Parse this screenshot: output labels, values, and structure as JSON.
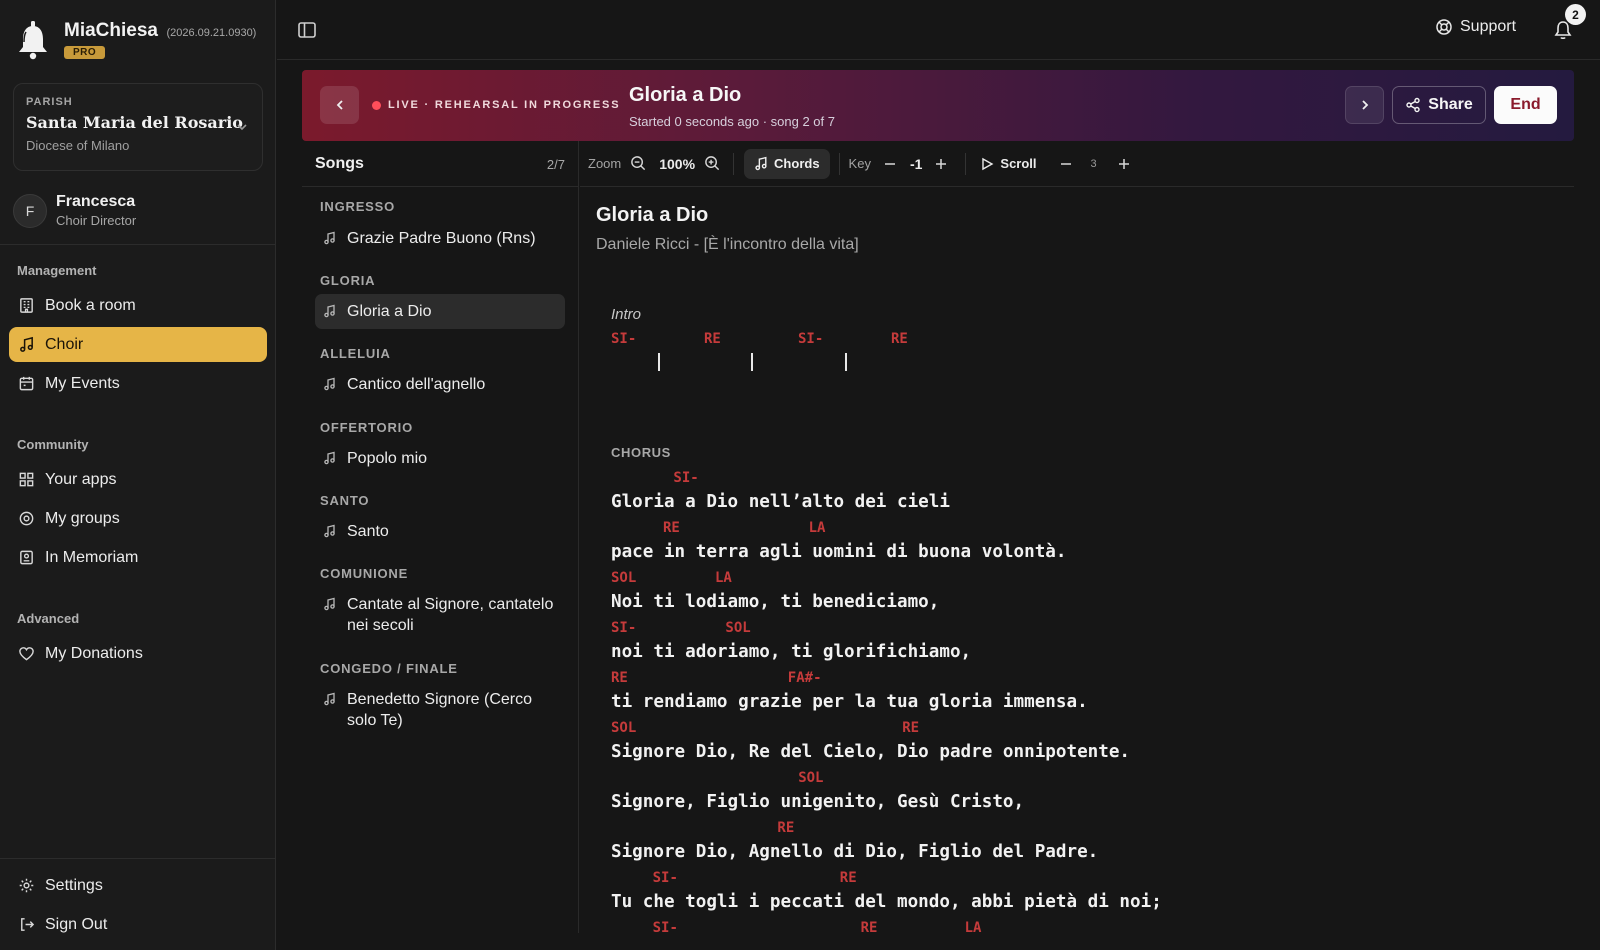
{
  "brand": {
    "name": "MiaChiesa",
    "version": "(2026.09.21.0930)",
    "badge": "PRO"
  },
  "parish": {
    "label": "PARISH",
    "name": "Santa Maria del Rosario",
    "diocese": "Diocese of Milano"
  },
  "user": {
    "initial": "F",
    "name": "Francesca",
    "role": "Choir Director"
  },
  "nav": {
    "management_label": "Management",
    "book_room": "Book a room",
    "choir": "Choir",
    "my_events": "My Events",
    "community_label": "Community",
    "your_apps": "Your apps",
    "my_groups": "My groups",
    "in_memoriam": "In Memoriam",
    "advanced_label": "Advanced",
    "my_donations": "My Donations",
    "settings": "Settings",
    "sign_out": "Sign Out"
  },
  "topbar": {
    "support": "Support",
    "notifications": "2"
  },
  "banner": {
    "live_label": "LIVE · REHEARSAL IN PROGRESS",
    "title": "Gloria a Dio",
    "subtitle": "Started 0 seconds ago · song 2 of 7",
    "share": "Share",
    "end": "End",
    "live_color": "#ff4d5a"
  },
  "songs": {
    "title": "Songs",
    "count": "2/7",
    "sections": [
      {
        "name": "INGRESSO",
        "songs": [
          "Grazie Padre Buono (Rns)"
        ]
      },
      {
        "name": "GLORIA",
        "songs": [
          "Gloria a Dio"
        ]
      },
      {
        "name": "ALLELUIA",
        "songs": [
          "Cantico dell'agnello"
        ]
      },
      {
        "name": "OFFERTORIO",
        "songs": [
          "Popolo mio"
        ]
      },
      {
        "name": "SANTO",
        "songs": [
          "Santo"
        ]
      },
      {
        "name": "COMUNIONE",
        "songs": [
          "Cantate al Signore, cantatelo nei secoli"
        ]
      },
      {
        "name": "CONGEDO / FINALE",
        "songs": [
          "Benedetto Signore (Cerco solo Te)"
        ]
      }
    ],
    "active_song": "Gloria a Dio"
  },
  "toolbar": {
    "zoom_label": "Zoom",
    "zoom_value": "100%",
    "chords": "Chords",
    "key_label": "Key",
    "key_value": "-1",
    "scroll": "Scroll",
    "scroll_speed": "3"
  },
  "sheet": {
    "title": "Gloria a Dio",
    "author": "Daniele Ricci - [È l'incontro della vita]",
    "intro_label": "Intro",
    "intro_chords": [
      "SI-",
      "RE",
      "SI-",
      "RE"
    ],
    "chorus_label": "CHORUS",
    "chord_color": "#c53b3b",
    "lines": [
      {
        "chords": [
          {
            "col": 6,
            "name": "SI-"
          }
        ],
        "text": "Gloria a Dio nell’alto dei cieli"
      },
      {
        "chords": [
          {
            "col": 5,
            "name": "RE"
          },
          {
            "col": 19,
            "name": "LA"
          }
        ],
        "text": "pace in terra agli uomini di buona volontà."
      },
      {
        "chords": [
          {
            "col": 0,
            "name": "SOL"
          },
          {
            "col": 10,
            "name": "LA"
          }
        ],
        "text": "Noi ti lodiamo, ti benediciamo,"
      },
      {
        "chords": [
          {
            "col": 0,
            "name": "SI-"
          },
          {
            "col": 11,
            "name": "SOL"
          }
        ],
        "text": "noi ti adoriamo, ti glorifichiamo,"
      },
      {
        "chords": [
          {
            "col": 0,
            "name": "RE"
          },
          {
            "col": 17,
            "name": "FA#-"
          }
        ],
        "text": "ti rendiamo grazie per la tua gloria immensa."
      },
      {
        "chords": [
          {
            "col": 0,
            "name": "SOL"
          },
          {
            "col": 28,
            "name": "RE"
          }
        ],
        "text": "Signore Dio, Re del Cielo, Dio padre onnipotente."
      },
      {
        "chords": [
          {
            "col": 18,
            "name": "SOL"
          }
        ],
        "text": "Signore, Figlio unigenito, Gesù Cristo,"
      },
      {
        "chords": [
          {
            "col": 16,
            "name": "RE"
          }
        ],
        "text": "Signore Dio, Agnello di Dio, Figlio del Padre."
      },
      {
        "chords": [
          {
            "col": 4,
            "name": "SI-"
          },
          {
            "col": 22,
            "name": "RE"
          }
        ],
        "text": "Tu che togli i peccati del mondo, abbi pietà di noi;"
      },
      {
        "chords": [
          {
            "col": 4,
            "name": "SI-"
          },
          {
            "col": 24,
            "name": "RE"
          },
          {
            "col": 34,
            "name": "LA"
          }
        ],
        "text": ""
      }
    ]
  }
}
